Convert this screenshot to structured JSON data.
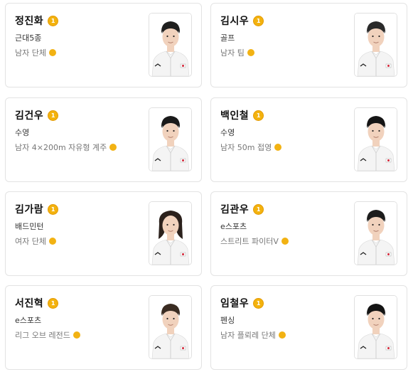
{
  "athletes": [
    {
      "name": "정진화",
      "sport": "근대5종",
      "event": "남자 단체",
      "hair": "#1f1f1f",
      "long_hair": false
    },
    {
      "name": "김시우",
      "sport": "골프",
      "event": "남자 팀",
      "hair": "#2a2a2a",
      "long_hair": false
    },
    {
      "name": "김건우",
      "sport": "수영",
      "event": "남자 4×200m 자유형 계주",
      "hair": "#1a1a1a",
      "long_hair": false
    },
    {
      "name": "백인철",
      "sport": "수영",
      "event": "남자 50m 접영",
      "hair": "#151515",
      "long_hair": false
    },
    {
      "name": "김가람",
      "sport": "배드민턴",
      "event": "여자 단체",
      "hair": "#2b211c",
      "long_hair": true
    },
    {
      "name": "김관우",
      "sport": "e스포츠",
      "event": "스트리트 파이터V",
      "hair": "#1c1c1c",
      "long_hair": false
    },
    {
      "name": "서진혁",
      "sport": "e스포츠",
      "event": "리그 오브 레전드",
      "hair": "#3a2c22",
      "long_hair": false
    },
    {
      "name": "임철우",
      "sport": "펜싱",
      "event": "남자 플뢰레 단체",
      "hair": "#141414",
      "long_hair": false
    }
  ],
  "medal": {
    "icon": "gold-medal-icon",
    "color": "#f3b20e",
    "number": "1"
  },
  "uniform": {
    "color": "#f4f4f4",
    "flag": "korean-flag-icon"
  }
}
